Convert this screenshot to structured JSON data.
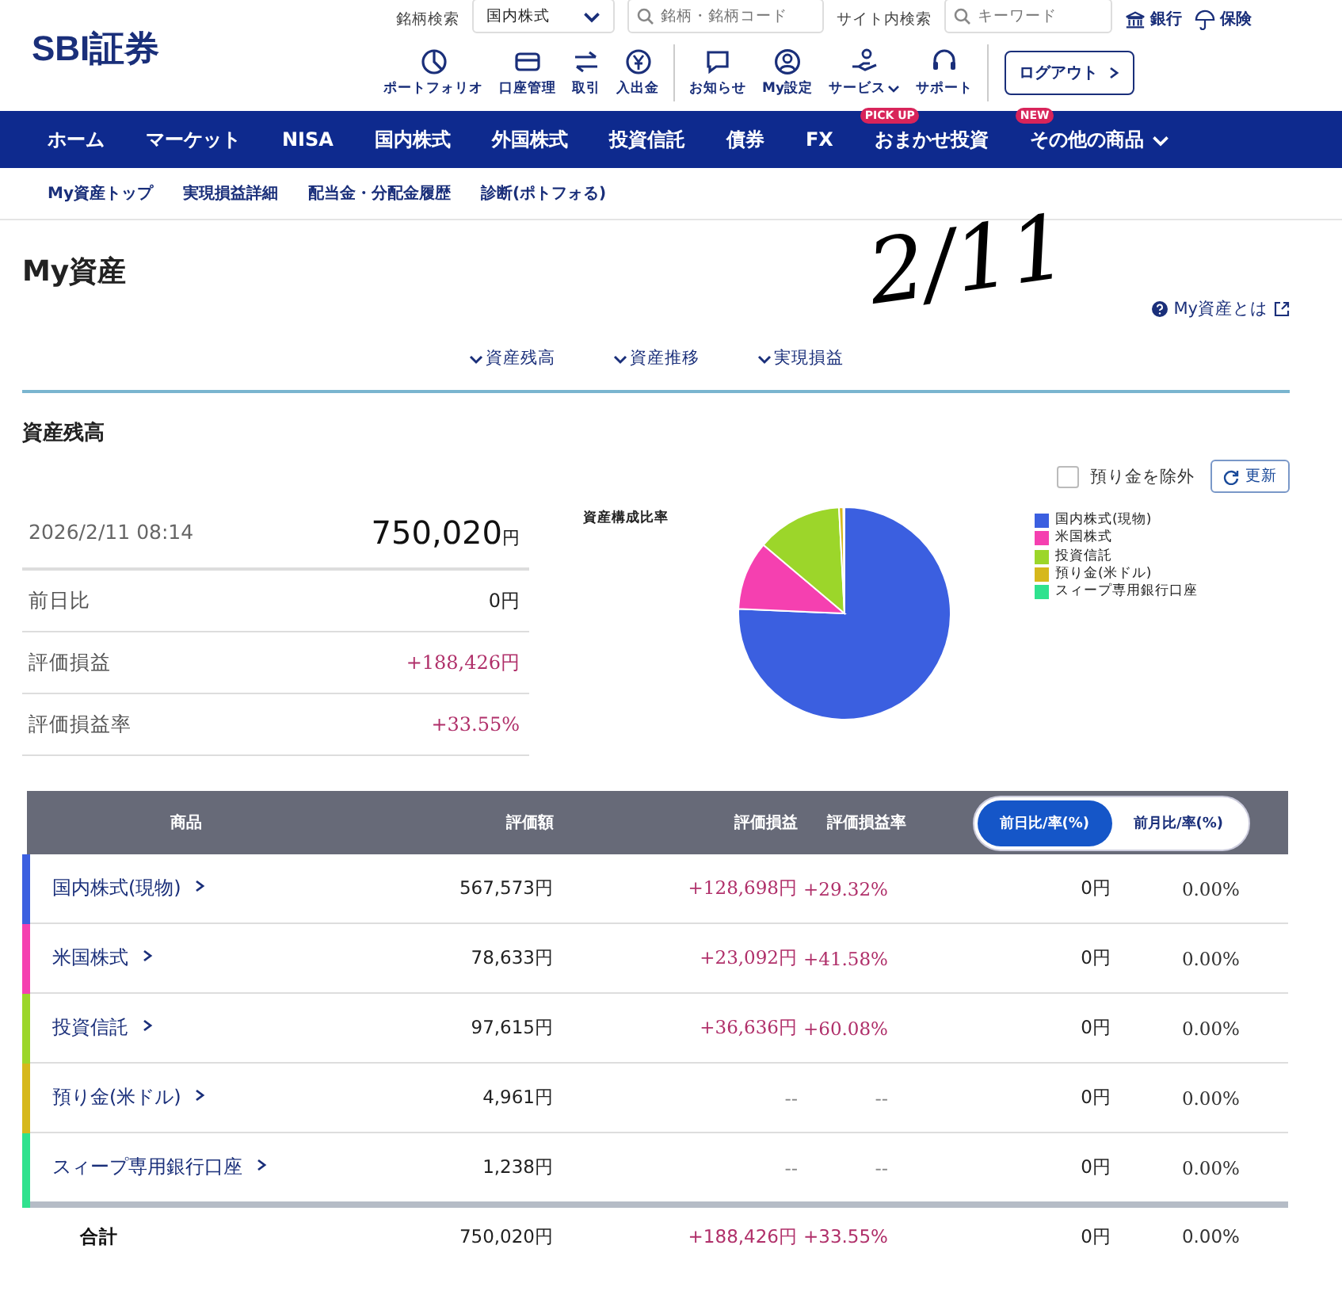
{
  "header": {
    "logo": "SBI証券",
    "brand_search": {
      "label": "銘柄検索",
      "dropdown": "国内株式",
      "placeholder": "銘柄・銘柄コード"
    },
    "site_search": {
      "label": "サイト内検索",
      "placeholder": "キーワード"
    },
    "links": [
      {
        "label": "銀行",
        "kind": "bank"
      },
      {
        "label": "保険",
        "kind": "umbrella"
      }
    ],
    "toolbar": [
      {
        "label": "ポートフォリオ",
        "kind": "pie",
        "dropdown": false
      },
      {
        "label": "口座管理",
        "kind": "card",
        "dropdown": false
      },
      {
        "label": "取引",
        "kind": "arrows",
        "dropdown": false
      },
      {
        "label": "入出金",
        "kind": "yen",
        "dropdown": false
      },
      {
        "label": "お知らせ",
        "kind": "chat",
        "dropdown": false
      },
      {
        "label": "My設定",
        "kind": "person",
        "dropdown": false
      },
      {
        "label": "サービス",
        "kind": "hand",
        "dropdown": true
      },
      {
        "label": "サポート",
        "kind": "headset",
        "dropdown": false
      }
    ],
    "logout": "ログアウト"
  },
  "nav": [
    {
      "label": "ホーム",
      "dropdown": false
    },
    {
      "label": "マーケット",
      "dropdown": false
    },
    {
      "label": "NISA",
      "dropdown": false
    },
    {
      "label": "国内株式",
      "dropdown": false
    },
    {
      "label": "外国株式",
      "dropdown": false
    },
    {
      "label": "投資信託",
      "dropdown": false
    },
    {
      "label": "債券",
      "dropdown": false
    },
    {
      "label": "FX",
      "dropdown": false
    },
    {
      "label": "おまかせ投資",
      "badge": "PICK UP",
      "dropdown": false
    },
    {
      "label": "その他の商品",
      "badge": "NEW",
      "dropdown": true
    }
  ],
  "subnav": [
    "My資産トップ",
    "実現損益詳細",
    "配当金・分配金履歴",
    "診断(ポトフォる)"
  ],
  "page_title": "My資産",
  "handwritten_note": "2/11",
  "help_link": "My資産とは",
  "section_tabs": [
    "資産残高",
    "資産推移",
    "実現損益"
  ],
  "balance": {
    "title": "資産残高",
    "exclude_deposit": {
      "label": "預り金を除外",
      "checked": false
    },
    "refresh": "更新",
    "date": "2026/2/11 08:14",
    "total": "750,020",
    "total_unit": "円",
    "rows": [
      {
        "label": "前日比",
        "value": "0円",
        "kind": "plain"
      },
      {
        "label": "評価損益",
        "value": "+188,426円",
        "kind": "gain"
      },
      {
        "label": "評価損益率",
        "value": "+33.55%",
        "kind": "gain"
      }
    ]
  },
  "chart": {
    "title": "資産構成比率",
    "legend": [
      {
        "label": "国内株式(現物)",
        "color": "#3b5fe0"
      },
      {
        "label": "米国株式",
        "color": "#f540b0"
      },
      {
        "label": "投資信託",
        "color": "#9cd62a"
      },
      {
        "label": "預り金(米ドル)",
        "color": "#d6b81c"
      },
      {
        "label": "スィープ専用銀行口座",
        "color": "#2fe28e"
      }
    ]
  },
  "table": {
    "columns": [
      "商品",
      "評価額",
      "評価損益",
      "評価損益率"
    ],
    "toggle": [
      {
        "label": "前日比/率(%)",
        "selected": true
      },
      {
        "label": "前月比/率(%)",
        "selected": false
      }
    ],
    "rows": [
      {
        "name": "国内株式(現物)",
        "color": "#3b5fe0",
        "value": "567,573円",
        "gain": "+128,698円",
        "gain_rate": "+29.32%",
        "change": "0円",
        "change_rate": "0.00%"
      },
      {
        "name": "米国株式",
        "color": "#f540b0",
        "value": "78,633円",
        "gain": "+23,092円",
        "gain_rate": "+41.58%",
        "change": "0円",
        "change_rate": "0.00%"
      },
      {
        "name": "投資信託",
        "color": "#9cd62a",
        "value": "97,615円",
        "gain": "+36,636円",
        "gain_rate": "+60.08%",
        "change": "0円",
        "change_rate": "0.00%"
      },
      {
        "name": "預り金(米ドル)",
        "color": "#d6b81c",
        "value": "4,961円",
        "gain": "--",
        "gain_rate": "--",
        "change": "0円",
        "change_rate": "0.00%"
      },
      {
        "name": "スィープ専用銀行口座",
        "color": "#2fe28e",
        "value": "1,238円",
        "gain": "--",
        "gain_rate": "--",
        "change": "0円",
        "change_rate": "0.00%"
      }
    ],
    "total": {
      "name": "合計",
      "value": "750,020円",
      "gain": "+188,426円",
      "gain_rate": "+33.55%",
      "change": "0円",
      "change_rate": "0.00%"
    }
  }
}
